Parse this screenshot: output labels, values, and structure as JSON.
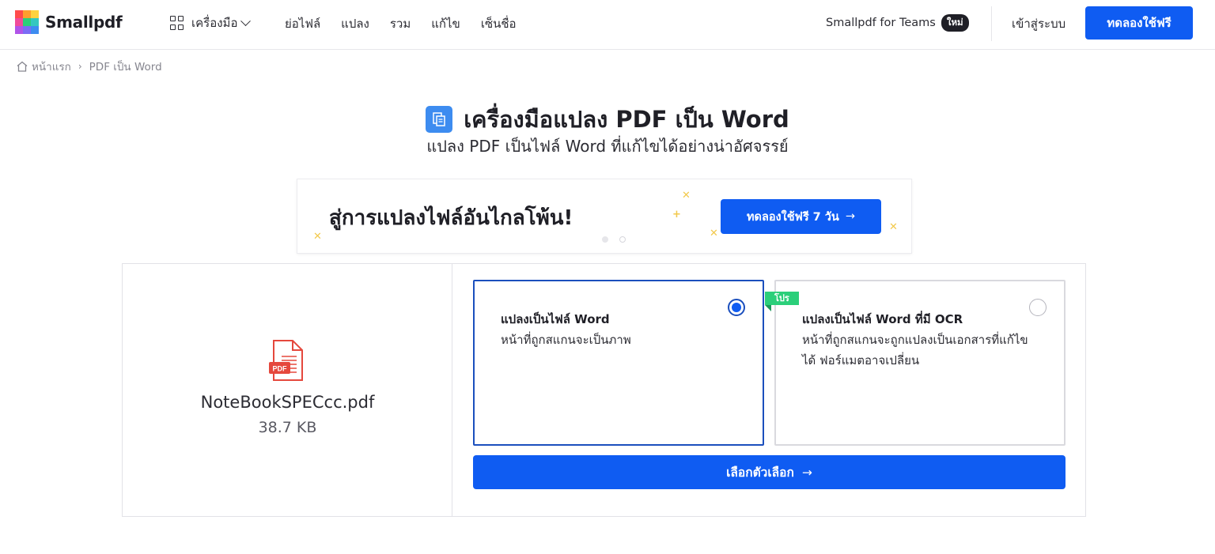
{
  "colors": {
    "accent": "#0f5cf2",
    "pro": "#2bcf7a",
    "selected_border": "#1b4fbd"
  },
  "header": {
    "logo_text": "Smallpdf",
    "tools_label": "เครื่องมือ",
    "nav": [
      "ย่อไฟล์",
      "แปลง",
      "รวม",
      "แก้ไข",
      "เซ็นชื่อ"
    ],
    "teams_label": "Smallpdf for Teams",
    "teams_badge": "ใหม่",
    "login_label": "เข้าสู่ระบบ",
    "trial_button": "ทดลองใช้ฟรี"
  },
  "breadcrumb": {
    "home": "หน้าแรก",
    "current": "PDF เป็น Word"
  },
  "page": {
    "title": "เครื่องมือแปลง PDF เป็น Word",
    "subtitle": "แปลง PDF เป็นไฟล์ Word ที่แก้ไขได้อย่างน่าอัศจรรย์"
  },
  "promo": {
    "text": "สู่การแปลงไฟล์อันไกลโพ้น!",
    "button": "ทดลองใช้ฟรี 7 วัน",
    "arrow": "→"
  },
  "file": {
    "icon_label": "PDF",
    "name": "NoteBookSPECcc.pdf",
    "size": "38.7 KB"
  },
  "options": [
    {
      "title": "แปลงเป็นไฟล์ Word",
      "description": "หน้าที่ถูกสแกนจะเป็นภาพ",
      "selected": true
    },
    {
      "title": "แปลงเป็นไฟล์ Word ที่มี OCR",
      "description": "หน้าที่ถูกสแกนจะถูกแปลงเป็นเอกสารที่แก้ไขได้ ฟอร์แมตอาจเปลี่ยน",
      "badge": "โปร",
      "selected": false
    }
  ],
  "choose_button": {
    "label": "เลือกตัวเลือก",
    "arrow": "→"
  }
}
